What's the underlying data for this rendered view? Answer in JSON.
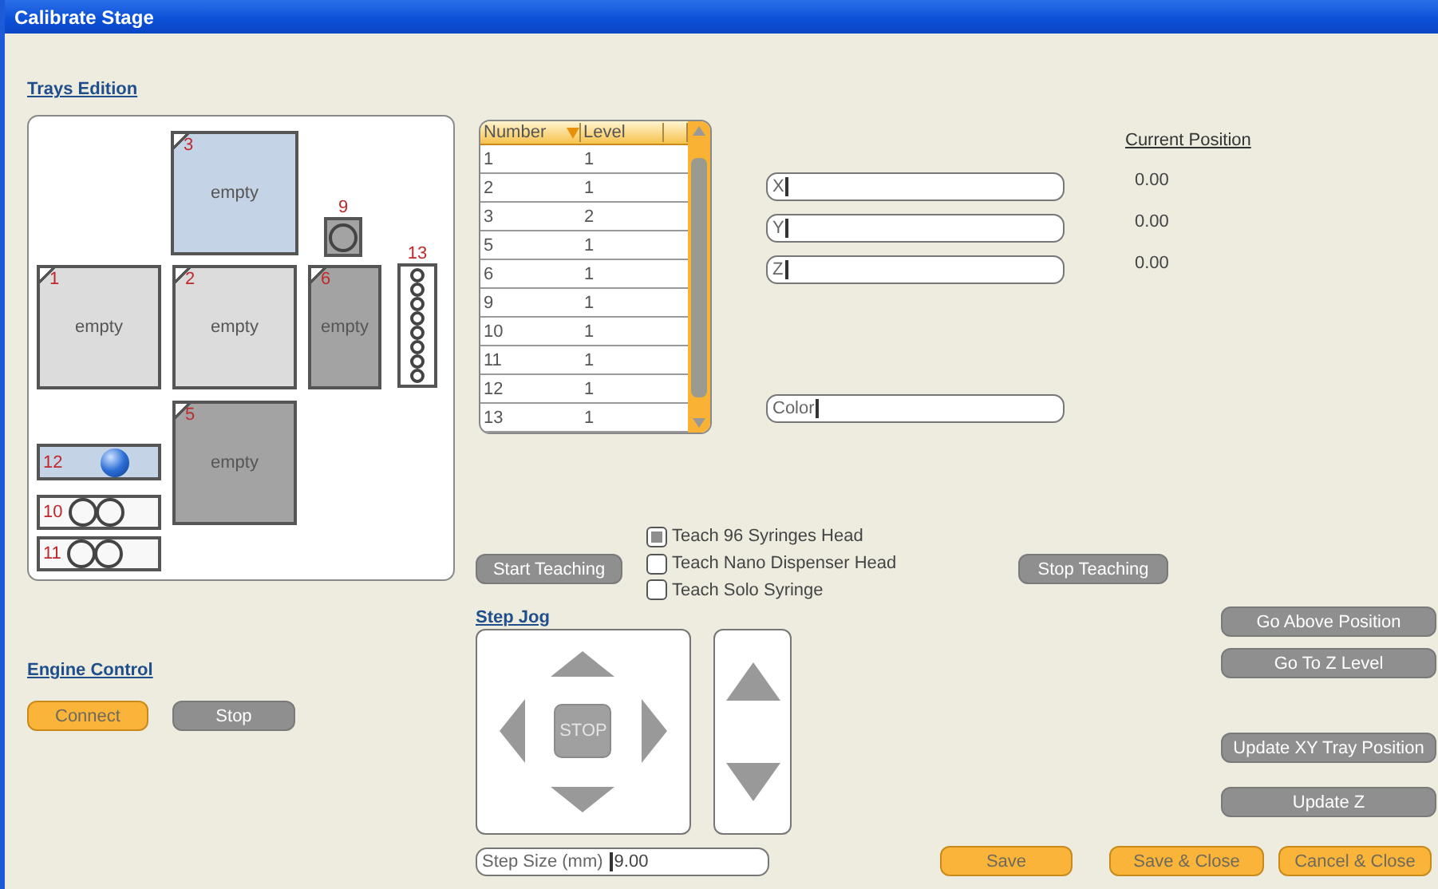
{
  "window": {
    "title": "Calibrate Stage"
  },
  "trays_section": {
    "heading": "Trays Edition",
    "trays": [
      {
        "number": "3",
        "kind": "plate",
        "label": "empty",
        "color": "#c5d3e6"
      },
      {
        "number": "9",
        "kind": "vial",
        "color": "#a3a3a3"
      },
      {
        "number": "1",
        "kind": "plate",
        "label": "empty",
        "color": "#dcdcdc"
      },
      {
        "number": "2",
        "kind": "plate",
        "label": "empty",
        "color": "#dcdcdc"
      },
      {
        "number": "6",
        "kind": "plate",
        "label": "empty",
        "color": "#a3a3a3"
      },
      {
        "number": "13",
        "kind": "rack",
        "color": "#ffffff"
      },
      {
        "number": "12",
        "kind": "ball",
        "color": "#c5d3e6"
      },
      {
        "number": "5",
        "kind": "plate",
        "label": "empty",
        "color": "#a3a3a3"
      },
      {
        "number": "10",
        "kind": "pair",
        "color": "#f8f8f8"
      },
      {
        "number": "11",
        "kind": "pair",
        "color": "#f8f8f8"
      }
    ]
  },
  "tray_table": {
    "columns": [
      {
        "label": "Number",
        "sorted": true
      },
      {
        "label": "Level",
        "sorted": false
      }
    ],
    "rows": [
      {
        "number": "1",
        "level": "1"
      },
      {
        "number": "2",
        "level": "1"
      },
      {
        "number": "3",
        "level": "2"
      },
      {
        "number": "5",
        "level": "1"
      },
      {
        "number": "6",
        "level": "1"
      },
      {
        "number": "9",
        "level": "1"
      },
      {
        "number": "10",
        "level": "1"
      },
      {
        "number": "11",
        "level": "1"
      },
      {
        "number": "12",
        "level": "1"
      },
      {
        "number": "13",
        "level": "1"
      }
    ]
  },
  "coordinate_fields": [
    {
      "label": "X"
    },
    {
      "label": "Y"
    },
    {
      "label": "Z"
    }
  ],
  "color_field": {
    "label": "Color"
  },
  "current_position": {
    "heading": "Current Position",
    "values": [
      "0.00",
      "0.00",
      "0.00"
    ]
  },
  "teaching": {
    "start_button": {
      "label": "Start Teaching",
      "disabled": true
    },
    "options": [
      {
        "label": "Teach 96 Syringes Head",
        "checked": true
      },
      {
        "label": "Teach Nano Dispenser Head",
        "checked": false
      },
      {
        "label": "Teach Solo Syringe",
        "checked": false
      }
    ],
    "stop_button": {
      "label": "Stop Teaching",
      "disabled": true
    }
  },
  "step_jog": {
    "heading": "Step Jog",
    "stop_label": "STOP",
    "step_size": {
      "label": "Step Size (mm)",
      "value": "9.00"
    }
  },
  "engine_control": {
    "heading": "Engine Control",
    "buttons": [
      {
        "label": "Connect",
        "disabled": false
      },
      {
        "label": "Stop",
        "disabled": true
      }
    ]
  },
  "position_buttons": [
    {
      "label": "Go Above Position",
      "disabled": true
    },
    {
      "label": "Go To Z Level",
      "disabled": true
    },
    {
      "label": "Update XY Tray Position",
      "disabled": true
    },
    {
      "label": "Update Z",
      "disabled": true
    }
  ],
  "footer_buttons": [
    {
      "label": "Save",
      "disabled": false
    },
    {
      "label": "Save & Close",
      "disabled": false
    },
    {
      "label": "Cancel & Close",
      "disabled": false
    }
  ]
}
